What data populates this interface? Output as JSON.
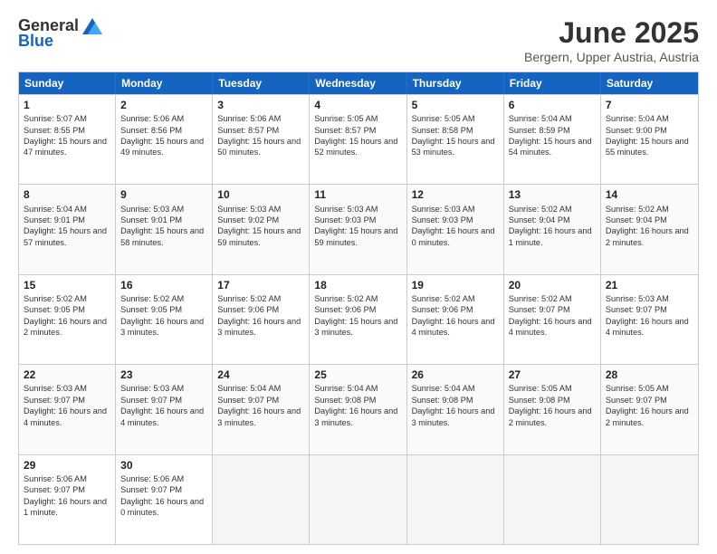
{
  "logo": {
    "general": "General",
    "blue": "Blue"
  },
  "title": "June 2025",
  "subtitle": "Bergern, Upper Austria, Austria",
  "days": [
    "Sunday",
    "Monday",
    "Tuesday",
    "Wednesday",
    "Thursday",
    "Friday",
    "Saturday"
  ],
  "weeks": [
    [
      {
        "day": "1",
        "sunrise": "Sunrise: 5:07 AM",
        "sunset": "Sunset: 8:55 PM",
        "daylight": "Daylight: 15 hours and 47 minutes."
      },
      {
        "day": "2",
        "sunrise": "Sunrise: 5:06 AM",
        "sunset": "Sunset: 8:56 PM",
        "daylight": "Daylight: 15 hours and 49 minutes."
      },
      {
        "day": "3",
        "sunrise": "Sunrise: 5:06 AM",
        "sunset": "Sunset: 8:57 PM",
        "daylight": "Daylight: 15 hours and 50 minutes."
      },
      {
        "day": "4",
        "sunrise": "Sunrise: 5:05 AM",
        "sunset": "Sunset: 8:57 PM",
        "daylight": "Daylight: 15 hours and 52 minutes."
      },
      {
        "day": "5",
        "sunrise": "Sunrise: 5:05 AM",
        "sunset": "Sunset: 8:58 PM",
        "daylight": "Daylight: 15 hours and 53 minutes."
      },
      {
        "day": "6",
        "sunrise": "Sunrise: 5:04 AM",
        "sunset": "Sunset: 8:59 PM",
        "daylight": "Daylight: 15 hours and 54 minutes."
      },
      {
        "day": "7",
        "sunrise": "Sunrise: 5:04 AM",
        "sunset": "Sunset: 9:00 PM",
        "daylight": "Daylight: 15 hours and 55 minutes."
      }
    ],
    [
      {
        "day": "8",
        "sunrise": "Sunrise: 5:04 AM",
        "sunset": "Sunset: 9:01 PM",
        "daylight": "Daylight: 15 hours and 57 minutes."
      },
      {
        "day": "9",
        "sunrise": "Sunrise: 5:03 AM",
        "sunset": "Sunset: 9:01 PM",
        "daylight": "Daylight: 15 hours and 58 minutes."
      },
      {
        "day": "10",
        "sunrise": "Sunrise: 5:03 AM",
        "sunset": "Sunset: 9:02 PM",
        "daylight": "Daylight: 15 hours and 59 minutes."
      },
      {
        "day": "11",
        "sunrise": "Sunrise: 5:03 AM",
        "sunset": "Sunset: 9:03 PM",
        "daylight": "Daylight: 15 hours and 59 minutes."
      },
      {
        "day": "12",
        "sunrise": "Sunrise: 5:03 AM",
        "sunset": "Sunset: 9:03 PM",
        "daylight": "Daylight: 16 hours and 0 minutes."
      },
      {
        "day": "13",
        "sunrise": "Sunrise: 5:02 AM",
        "sunset": "Sunset: 9:04 PM",
        "daylight": "Daylight: 16 hours and 1 minute."
      },
      {
        "day": "14",
        "sunrise": "Sunrise: 5:02 AM",
        "sunset": "Sunset: 9:04 PM",
        "daylight": "Daylight: 16 hours and 2 minutes."
      }
    ],
    [
      {
        "day": "15",
        "sunrise": "Sunrise: 5:02 AM",
        "sunset": "Sunset: 9:05 PM",
        "daylight": "Daylight: 16 hours and 2 minutes."
      },
      {
        "day": "16",
        "sunrise": "Sunrise: 5:02 AM",
        "sunset": "Sunset: 9:05 PM",
        "daylight": "Daylight: 16 hours and 3 minutes."
      },
      {
        "day": "17",
        "sunrise": "Sunrise: 5:02 AM",
        "sunset": "Sunset: 9:06 PM",
        "daylight": "Daylight: 16 hours and 3 minutes."
      },
      {
        "day": "18",
        "sunrise": "Sunrise: 5:02 AM",
        "sunset": "Sunset: 9:06 PM",
        "daylight": "Daylight: 15 hours and 3 minutes."
      },
      {
        "day": "19",
        "sunrise": "Sunrise: 5:02 AM",
        "sunset": "Sunset: 9:06 PM",
        "daylight": "Daylight: 16 hours and 4 minutes."
      },
      {
        "day": "20",
        "sunrise": "Sunrise: 5:02 AM",
        "sunset": "Sunset: 9:07 PM",
        "daylight": "Daylight: 16 hours and 4 minutes."
      },
      {
        "day": "21",
        "sunrise": "Sunrise: 5:03 AM",
        "sunset": "Sunset: 9:07 PM",
        "daylight": "Daylight: 16 hours and 4 minutes."
      }
    ],
    [
      {
        "day": "22",
        "sunrise": "Sunrise: 5:03 AM",
        "sunset": "Sunset: 9:07 PM",
        "daylight": "Daylight: 16 hours and 4 minutes."
      },
      {
        "day": "23",
        "sunrise": "Sunrise: 5:03 AM",
        "sunset": "Sunset: 9:07 PM",
        "daylight": "Daylight: 16 hours and 4 minutes."
      },
      {
        "day": "24",
        "sunrise": "Sunrise: 5:04 AM",
        "sunset": "Sunset: 9:07 PM",
        "daylight": "Daylight: 16 hours and 3 minutes."
      },
      {
        "day": "25",
        "sunrise": "Sunrise: 5:04 AM",
        "sunset": "Sunset: 9:08 PM",
        "daylight": "Daylight: 16 hours and 3 minutes."
      },
      {
        "day": "26",
        "sunrise": "Sunrise: 5:04 AM",
        "sunset": "Sunset: 9:08 PM",
        "daylight": "Daylight: 16 hours and 3 minutes."
      },
      {
        "day": "27",
        "sunrise": "Sunrise: 5:05 AM",
        "sunset": "Sunset: 9:08 PM",
        "daylight": "Daylight: 16 hours and 2 minutes."
      },
      {
        "day": "28",
        "sunrise": "Sunrise: 5:05 AM",
        "sunset": "Sunset: 9:07 PM",
        "daylight": "Daylight: 16 hours and 2 minutes."
      }
    ],
    [
      {
        "day": "29",
        "sunrise": "Sunrise: 5:06 AM",
        "sunset": "Sunset: 9:07 PM",
        "daylight": "Daylight: 16 hours and 1 minute."
      },
      {
        "day": "30",
        "sunrise": "Sunrise: 5:06 AM",
        "sunset": "Sunset: 9:07 PM",
        "daylight": "Daylight: 16 hours and 0 minutes."
      },
      null,
      null,
      null,
      null,
      null
    ]
  ]
}
